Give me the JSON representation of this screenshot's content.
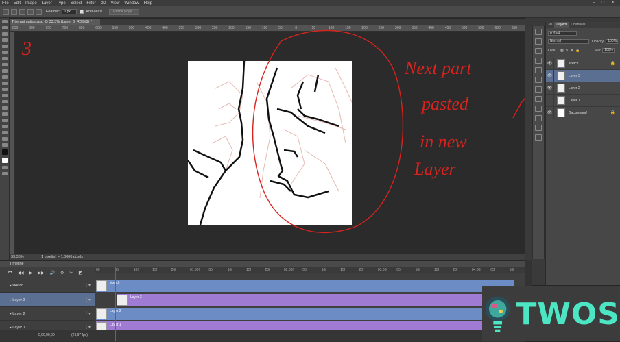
{
  "menubar": {
    "items": [
      "File",
      "Edit",
      "Image",
      "Layer",
      "Type",
      "Select",
      "Filter",
      "3D",
      "View",
      "Window",
      "Help"
    ],
    "window_controls": "‒ □ ✕"
  },
  "options": {
    "feather_label": "Feather:",
    "feather_value": "0 px",
    "antialias_label": "Anti-alias",
    "refine_label": "Refine Edge..."
  },
  "document": {
    "tab_title": "Title animation.psd @ 33,3% (Layer 3, RGB/8) *"
  },
  "ruler_top": [
    "850",
    "800",
    "750",
    "700",
    "650",
    "600",
    "550",
    "500",
    "450",
    "400",
    "350",
    "300",
    "250",
    "200",
    "150",
    "100",
    "50",
    "0",
    "50",
    "100",
    "150",
    "200",
    "250",
    "300",
    "350",
    "400",
    "450",
    "500",
    "550",
    "600",
    "650"
  ],
  "statusbar": {
    "zoom": "33,33%",
    "info": "1 pixel(s) = 1,0000 pixels"
  },
  "annotations": {
    "number": "3",
    "line1": "Next part",
    "line2": "pasted",
    "line3": "in new",
    "line4": "Layer"
  },
  "layers_panel": {
    "tabs": [
      "3D",
      "Layers",
      "Channels"
    ],
    "kind_label": "ρ Kind",
    "blend_mode": "Normal",
    "opacity_label": "Opacity:",
    "opacity_value": "100%",
    "lock_label": "Lock:",
    "fill_label": "Fill:",
    "fill_value": "100%",
    "layers": [
      {
        "name": "sketch",
        "visible": true,
        "locked": true
      },
      {
        "name": "Layer 3",
        "visible": true,
        "selected": true
      },
      {
        "name": "Layer 2",
        "visible": true
      },
      {
        "name": "Layer 1",
        "visible": false
      },
      {
        "name": "Background",
        "visible": true,
        "locked": true
      }
    ]
  },
  "timeline": {
    "title": "Timeline",
    "timecode": "0;00;00;00",
    "fps": "(29,97 fps)",
    "ruler": [
      "00",
      "05",
      "10f",
      "15f",
      "20f",
      "01:00f",
      "05f",
      "10f",
      "15f",
      "20f",
      "02:00f",
      "05f",
      "10f",
      "15f",
      "20f",
      "03:00f",
      "05f",
      "10f",
      "15f",
      "20f",
      "04:00f",
      "05f",
      "10f"
    ],
    "tracks": [
      {
        "label": "sketch",
        "clip_label": "sketch"
      },
      {
        "label": "Layer 3",
        "clip_label": "Layer 3"
      },
      {
        "label": "Layer 2",
        "clip_label": "Layer 2"
      },
      {
        "label": "Layer 1",
        "clip_label": "Layer 1"
      }
    ]
  },
  "logo": {
    "text": "TWOS"
  },
  "colors": {
    "annotation_red": "#d8231e",
    "clip_blue": "#6b8cc5",
    "clip_purple": "#a07bd4",
    "selected_layer": "#5b6f92",
    "logo_teal": "#4de6c4"
  }
}
